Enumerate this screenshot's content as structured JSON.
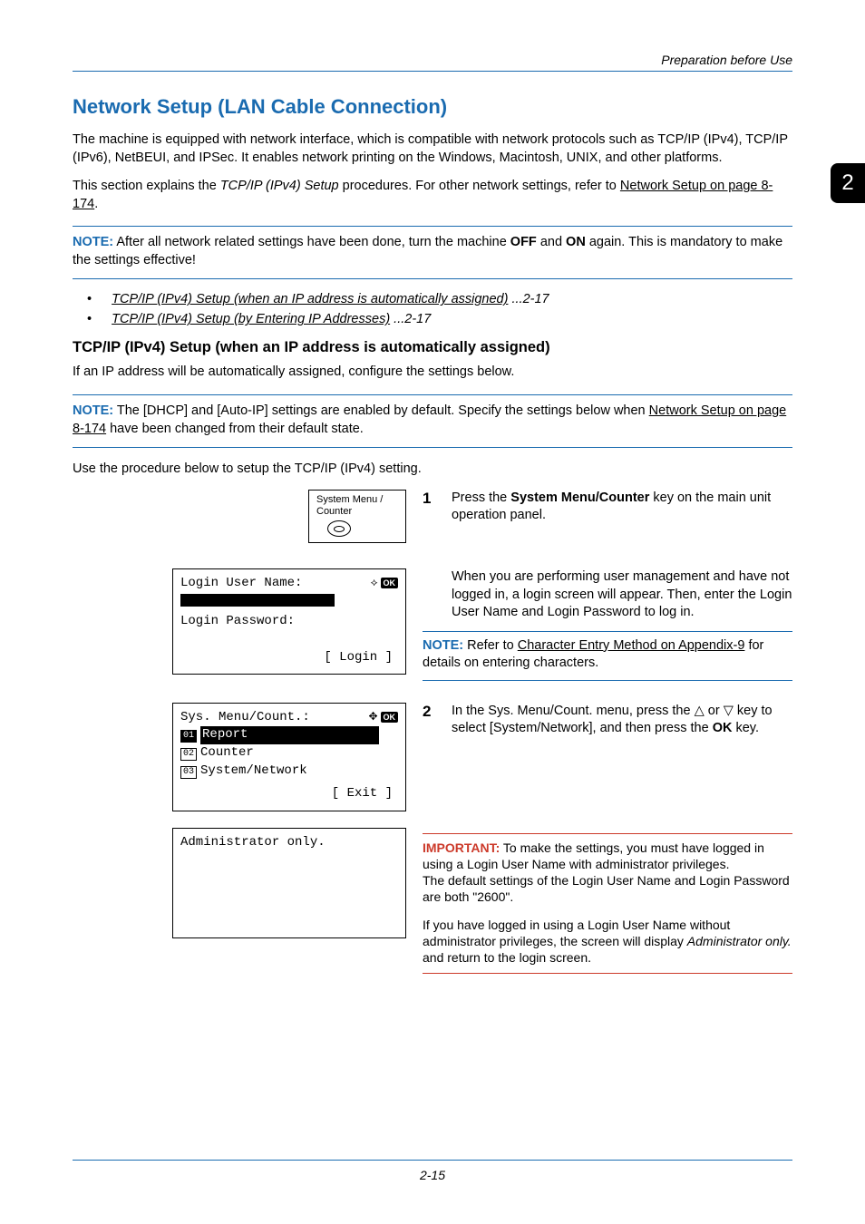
{
  "header": {
    "topRight": "Preparation before Use"
  },
  "sideTab": "2",
  "title": "Network Setup (LAN Cable Connection)",
  "intro1": "The machine is equipped with network interface, which is compatible with network protocols such as TCP/IP (IPv4), TCP/IP (IPv6), NetBEUI, and IPSec. It enables network printing on the Windows, Macintosh, UNIX, and other platforms.",
  "intro2a": "This section explains the ",
  "intro2i": "TCP/IP (IPv4) Setup",
  "intro2b": " procedures. For other network settings, refer to ",
  "intro2link": "Network Setup on page 8-174",
  "intro2c": ".",
  "note1": {
    "label": "NOTE:",
    "textA": " After all network related settings have been done, turn the machine ",
    "off": "OFF",
    "mid": " and ",
    "on": "ON",
    "textB": " again. This is mandatory to make the settings effective!"
  },
  "links": {
    "l1": "TCP/IP (IPv4) Setup (when an IP address is automatically assigned)",
    "l1page": " ...2-17",
    "l2": "TCP/IP (IPv4) Setup (by Entering IP Addresses)",
    "l2page": " ...2-17"
  },
  "subheading": "TCP/IP (IPv4) Setup (when an IP address is automatically assigned)",
  "subintro": "If an IP address will be automatically assigned, configure the settings below.",
  "note2": {
    "label": "NOTE:",
    "textA": " The [DHCP] and [Auto-IP] settings are enabled by default. Specify the settings below when ",
    "link": "Network Setup on page 8-174",
    "textB": " have been changed from their default state."
  },
  "procIntro": "Use the procedure below to setup the TCP/IP (IPv4) setting.",
  "keyLabel": "System Menu / Counter",
  "step1": {
    "num": "1",
    "a": "Press the ",
    "b": "System Menu/Counter",
    "c": " key on the main unit operation panel."
  },
  "loginIndent": "When you are performing user management and have not logged in, a login screen will appear. Then, enter the Login User Name and Login Password to log in.",
  "screen1": {
    "line1a": "Login User Name:",
    "ok": "OK",
    "line2": "Login Password:",
    "action": "[ Login  ]"
  },
  "rightNote": {
    "label": "NOTE:",
    "a": " Refer to ",
    "link": "Character Entry Method on Appendix-9",
    "b": " for details on entering characters."
  },
  "step2": {
    "num": "2",
    "a": "In the Sys. Menu/Count. menu, press the ",
    "up": "△",
    "mid": " or ",
    "dn": "▽",
    "b": " key to select [System/Network], and then press the ",
    "ok": "OK",
    "c": " key."
  },
  "screen2": {
    "titleA": "Sys. Menu/Count.:",
    "ok": "OK",
    "r1num": "01",
    "r1": "Report",
    "r2num": "02",
    "r2": "Counter",
    "r3num": "03",
    "r3": "System/Network",
    "action": "[ Exit   ]"
  },
  "screen3": {
    "text": "Administrator only."
  },
  "rightImp": {
    "label": "IMPORTANT:",
    "p1": " To make the settings, you must have logged in using a Login User Name with administrator privileges.",
    "p2": "The default settings of the Login User Name and Login Password are both \"2600\".",
    "p3a": "If you have logged in using a Login User Name without administrator privileges, the screen will display ",
    "p3i": "Administrator only.",
    "p3b": " and return to the login screen."
  },
  "footer": "2-15"
}
